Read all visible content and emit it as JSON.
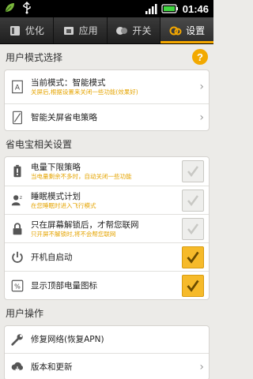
{
  "status_bar": {
    "time": "01:46",
    "left_icons": [
      "leaf-icon",
      "usb-icon"
    ],
    "right_icons": [
      "signal-icon",
      "battery-icon"
    ]
  },
  "tabs": [
    {
      "label": "优化",
      "icon": "optimize-icon",
      "active": false
    },
    {
      "label": "应用",
      "icon": "apps-icon",
      "active": false
    },
    {
      "label": "开关",
      "icon": "switch-icon",
      "active": false
    },
    {
      "label": "设置",
      "icon": "settings-icon",
      "active": true
    }
  ],
  "user_mode": {
    "header": "用户模式选择",
    "help": "?",
    "items": [
      {
        "title": "当前模式：智能模式",
        "subtitle": "关屏后,根据设置来关闭一些功能(效果好)",
        "icon": "mode-icon"
      },
      {
        "title": "智能关屏省电策略",
        "subtitle": "",
        "icon": "screen-icon"
      }
    ]
  },
  "saver": {
    "header": "省电宝相关设置",
    "items": [
      {
        "title": "电量下限策略",
        "subtitle": "当电量剩余不多时，自动关闭一些功能",
        "icon": "battery-alert-icon",
        "checked": false
      },
      {
        "title": "睡眠模式计划",
        "subtitle": "在您睡眠时进入飞行模式",
        "icon": "sleep-icon",
        "checked": false
      },
      {
        "title": "只在屏幕解锁后，才帮您联网",
        "subtitle": "只开屏不解锁时,将不会帮您联网",
        "icon": "lock-icon",
        "checked": false
      },
      {
        "title": "开机自启动",
        "subtitle": "",
        "icon": "power-icon",
        "checked": true
      },
      {
        "title": "显示顶部电量图标",
        "subtitle": "",
        "icon": "percent-icon",
        "checked": true
      }
    ]
  },
  "user_ops": {
    "header": "用户操作",
    "items": [
      {
        "title": "修复网络(恢复APN)",
        "icon": "wrench-icon"
      },
      {
        "title": "版本和更新",
        "icon": "update-icon"
      }
    ]
  },
  "colors": {
    "accent": "#f5a800",
    "subtitle": "#e5a400"
  }
}
